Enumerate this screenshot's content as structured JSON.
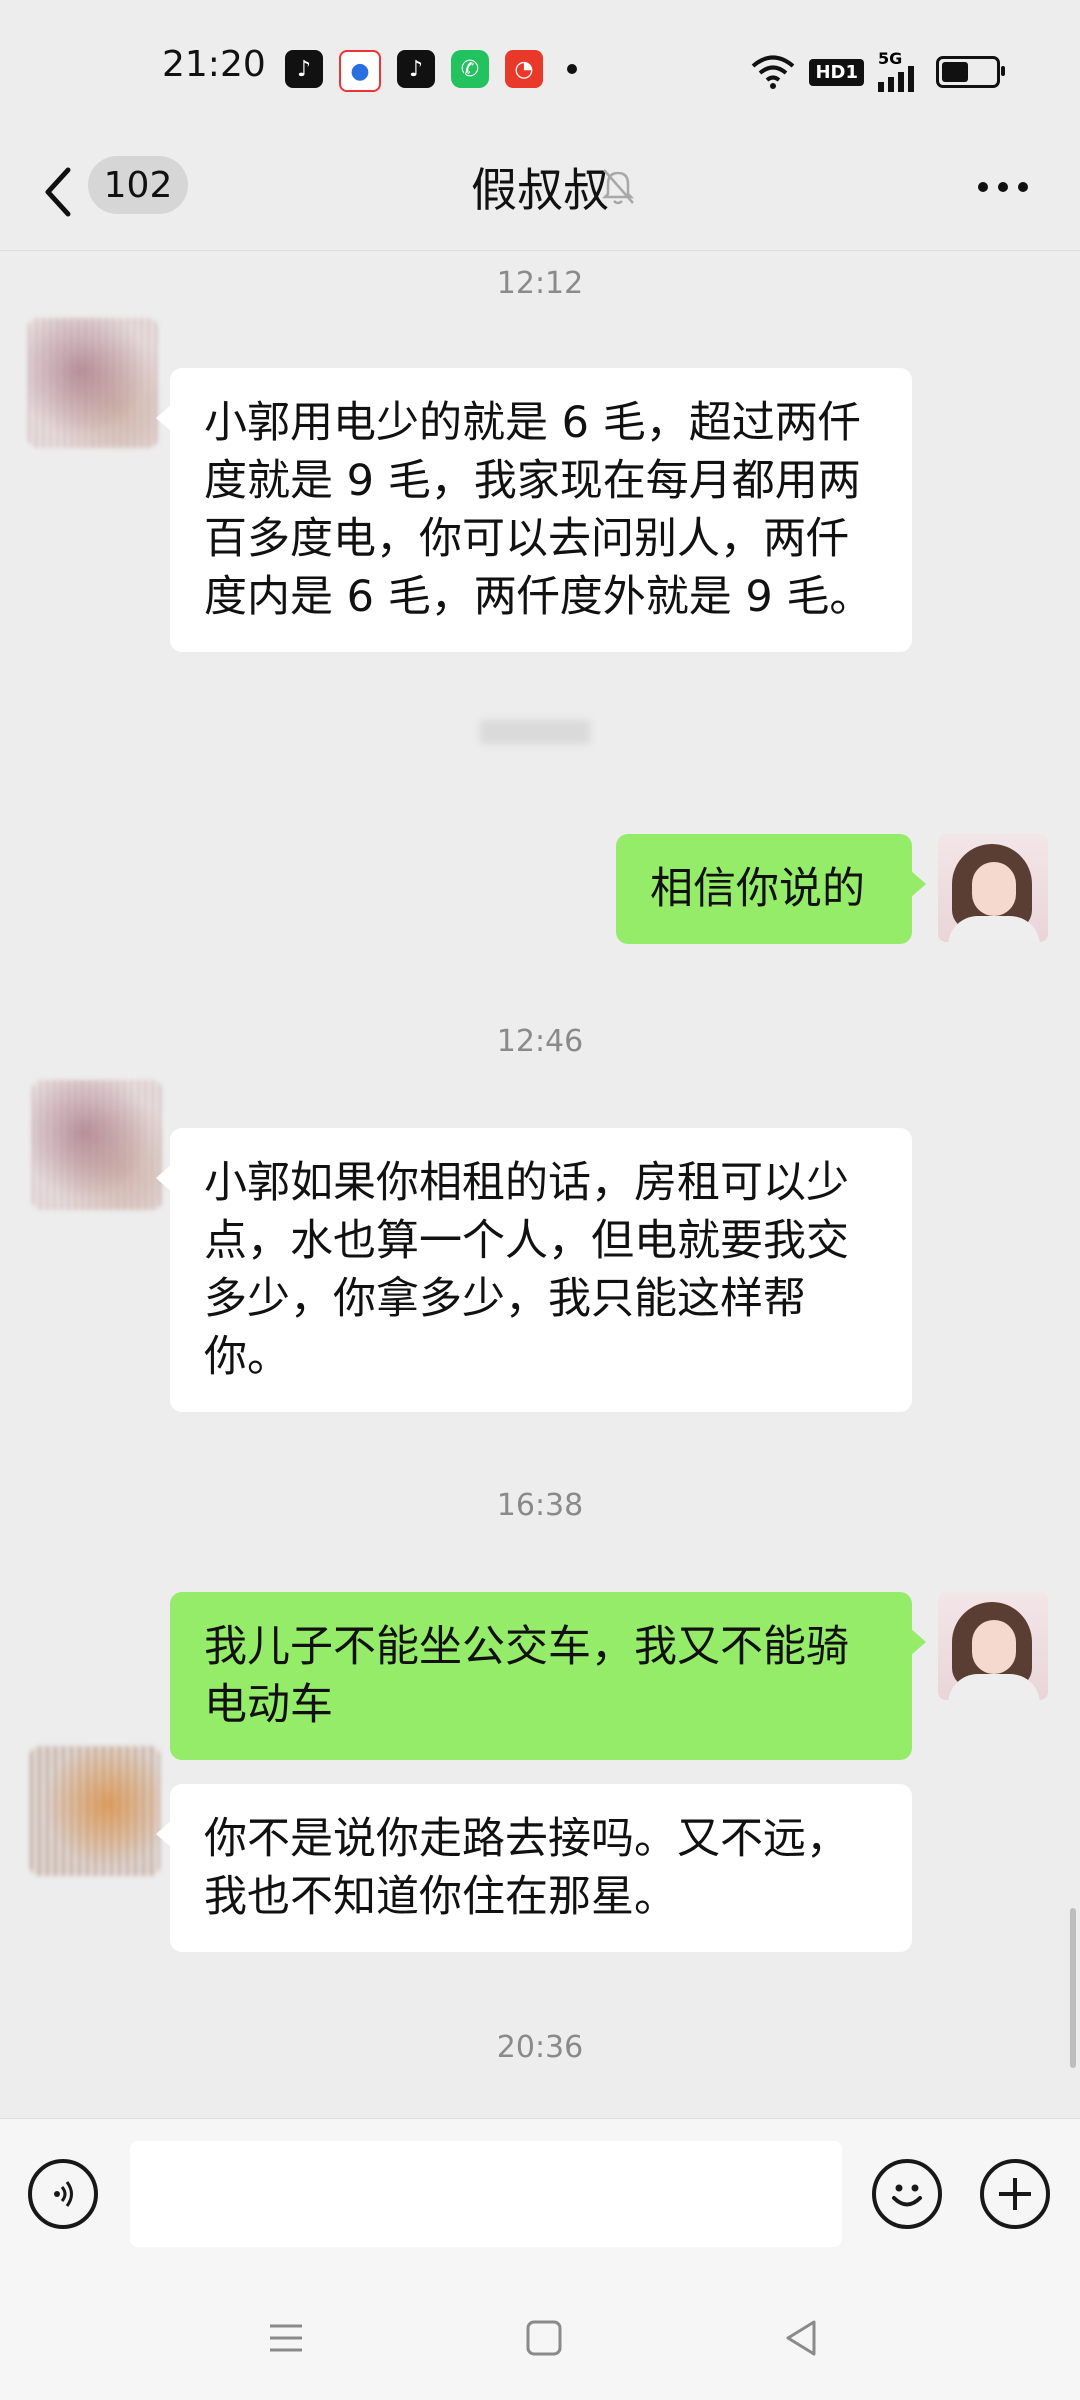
{
  "status_bar": {
    "time": "21:20",
    "network": "5G",
    "hd_label": "HD1",
    "battery_level": 0.45
  },
  "header": {
    "unread_count": "102",
    "title": "假叔叔",
    "icons": {
      "back": "chevron-left-icon",
      "mute": "bell-muted-icon",
      "more": "more-dots-icon"
    }
  },
  "messages": [
    {
      "type": "time",
      "text": "12:12"
    },
    {
      "type": "in",
      "text": "小郭用电少的就是 6 毛，超过两仟度就是 9 毛，我家现在每月都用两百多度电，你可以去问别人，两仟度内是 6 毛，两仟度外就是 9 毛。"
    },
    {
      "type": "out",
      "text": "相信你说的"
    },
    {
      "type": "time",
      "text": "12:46"
    },
    {
      "type": "in",
      "text": "小郭如果你相租的话，房租可以少点，水也算一个人，但电就要我交多少，你拿多少，我只能这样帮你。"
    },
    {
      "type": "time",
      "text": "16:38"
    },
    {
      "type": "out",
      "text": "我儿子不能坐公交车，我又不能骑电动车"
    },
    {
      "type": "in",
      "text": "你不是说你走路去接吗。又不远，我也不知道你住在那星。"
    },
    {
      "type": "time",
      "text": "20:36"
    }
  ],
  "input_bar": {
    "voice_icon": "voice-icon",
    "emoji_icon": "emoji-icon",
    "plus_icon": "plus-icon",
    "text_value": ""
  },
  "nav_bar": {
    "icons": [
      "menu-icon",
      "home-square-icon",
      "back-triangle-icon"
    ]
  }
}
